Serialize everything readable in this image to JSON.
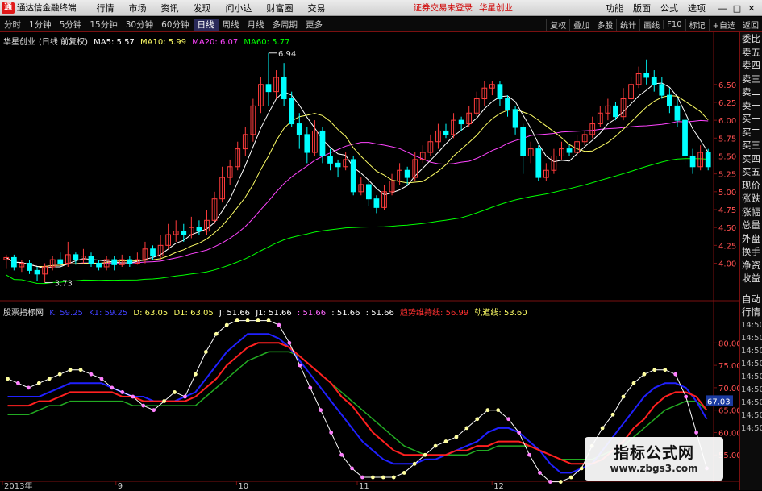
{
  "menubar": {
    "app_title": "通达信金融终端",
    "items": [
      "行情",
      "市场",
      "资讯",
      "发现",
      "问小达",
      "财富圈",
      "交易"
    ],
    "notice": "证券交易未登录",
    "notice2": "华星创业",
    "right_items": [
      "功能",
      "版面",
      "公式",
      "选项"
    ],
    "window_controls": [
      "—",
      "□",
      "✕"
    ]
  },
  "toolbar": {
    "periods": [
      "分时",
      "1分钟",
      "5分钟",
      "15分钟",
      "30分钟",
      "60分钟",
      "日线",
      "周线",
      "月线",
      "多周期",
      "更多"
    ],
    "active": "日线",
    "right_items": [
      "复权",
      "叠加",
      "多股",
      "统计",
      "画线",
      "F10",
      "标记",
      "+自选",
      "返回"
    ]
  },
  "main_info": {
    "stock": "华星创业",
    "mode": "(日线 前复权)",
    "ma5": "MA5: 5.57",
    "ma10": "MA10: 5.99",
    "ma20": "MA20: 6.07",
    "ma60": "MA60: 5.77"
  },
  "indicator_info": {
    "name": "股票指标网",
    "k": "K: 59.25",
    "k1": "K1: 59.25",
    "d": "D: 63.05",
    "d1": "D1: 63.05",
    "j": "J: 51.66",
    "j1": "J1: 51.66",
    "v1": ": 51.66",
    "v2": ": 51.66",
    "v3": ": 51.66",
    "trend": "趋势维持线: 56.99",
    "track": "轨道线: 53.60"
  },
  "annotations": {
    "high": "6.94",
    "low": "3.73"
  },
  "price_axis": [
    "6.50",
    "6.25",
    "6.00",
    "5.75",
    "5.50",
    "5.25",
    "5.00",
    "4.75",
    "4.50",
    "4.25",
    "4.00"
  ],
  "ind_axis": [
    "80.00",
    "75.00",
    "70.00",
    "65.00",
    "60.00",
    "55.00"
  ],
  "ind_current": "67.03",
  "date_axis": [
    "2013年",
    "9",
    "10",
    "11",
    "12"
  ],
  "right_panel": {
    "items": [
      "委比",
      "卖五",
      "卖四",
      "卖三",
      "卖二",
      "卖一",
      "买一",
      "买二",
      "买三",
      "买四",
      "买五",
      "现价",
      "涨跌",
      "涨幅",
      "总量",
      "外盘",
      "换手",
      "净资",
      "收益"
    ],
    "items2": [
      "自动",
      "行情"
    ],
    "times": [
      "14:50",
      "14:50",
      "14:50",
      "14:50",
      "14:50",
      "14:50",
      "14:50",
      "14:50",
      "14:50"
    ]
  },
  "watermark": {
    "title": "指标公式网",
    "url": "www.zbgs3.com"
  },
  "colors": {
    "up": "#ff3c3c",
    "down": "#00ffff",
    "ma5": "#ffffff",
    "ma10": "#ffff66",
    "ma20": "#ff44ff",
    "ma60": "#00ff00",
    "accent": "#7a1010"
  },
  "chart_data": {
    "type": "candlestick",
    "price_range": [
      3.6,
      7.05
    ],
    "candles": [
      [
        4.05,
        4.08,
        3.92,
        4.12
      ],
      [
        4.08,
        3.95,
        3.9,
        4.12
      ],
      [
        3.95,
        4.0,
        3.88,
        4.05
      ],
      [
        4.0,
        3.9,
        3.85,
        4.05
      ],
      [
        3.9,
        3.85,
        3.75,
        3.95
      ],
      [
        3.85,
        3.95,
        3.73,
        4.0
      ],
      [
        3.95,
        4.05,
        3.9,
        4.1
      ],
      [
        4.05,
        4.0,
        3.95,
        4.15
      ],
      [
        4.0,
        4.12,
        3.95,
        4.3
      ],
      [
        4.12,
        4.05,
        3.98,
        4.15
      ],
      [
        4.05,
        4.1,
        4.0,
        4.2
      ],
      [
        4.1,
        4.0,
        3.95,
        4.15
      ],
      [
        4.0,
        3.95,
        3.9,
        4.05
      ],
      [
        3.95,
        4.05,
        3.9,
        4.1
      ],
      [
        4.05,
        3.98,
        3.9,
        4.1
      ],
      [
        3.98,
        4.05,
        3.95,
        4.12
      ],
      [
        4.05,
        4.0,
        3.95,
        4.1
      ],
      [
        4.0,
        4.05,
        3.98,
        4.15
      ],
      [
        4.05,
        4.2,
        4.0,
        4.3
      ],
      [
        4.2,
        4.1,
        4.05,
        4.25
      ],
      [
        4.1,
        4.25,
        4.05,
        4.4
      ],
      [
        4.25,
        4.4,
        4.2,
        4.55
      ],
      [
        4.4,
        4.45,
        4.3,
        4.6
      ],
      [
        4.45,
        4.4,
        4.3,
        4.55
      ],
      [
        4.4,
        4.5,
        4.35,
        4.65
      ],
      [
        4.5,
        4.45,
        4.4,
        4.6
      ],
      [
        4.45,
        4.6,
        4.4,
        4.75
      ],
      [
        4.6,
        4.9,
        4.55,
        5.0
      ],
      [
        4.9,
        5.2,
        4.85,
        5.35
      ],
      [
        5.2,
        5.35,
        5.1,
        5.45
      ],
      [
        5.35,
        5.6,
        5.3,
        5.7
      ],
      [
        5.6,
        5.8,
        5.5,
        5.9
      ],
      [
        5.8,
        6.2,
        5.7,
        6.3
      ],
      [
        6.2,
        6.5,
        6.1,
        6.6
      ],
      [
        6.5,
        6.4,
        6.2,
        6.94
      ],
      [
        6.4,
        6.6,
        6.3,
        6.7
      ],
      [
        6.6,
        6.3,
        6.2,
        6.8
      ],
      [
        6.3,
        5.95,
        5.9,
        6.4
      ],
      [
        5.95,
        5.8,
        5.6,
        6.1
      ],
      [
        5.8,
        5.55,
        5.4,
        5.9
      ],
      [
        5.55,
        5.85,
        5.5,
        6.0
      ],
      [
        5.85,
        5.5,
        5.4,
        5.9
      ],
      [
        5.5,
        5.4,
        5.3,
        5.6
      ],
      [
        5.4,
        5.35,
        5.2,
        5.45
      ],
      [
        5.35,
        5.45,
        5.3,
        5.55
      ],
      [
        5.45,
        5.0,
        4.95,
        5.5
      ],
      [
        5.0,
        5.1,
        4.95,
        5.2
      ],
      [
        5.1,
        4.9,
        4.8,
        5.15
      ],
      [
        4.9,
        4.78,
        4.7,
        4.95
      ],
      [
        4.78,
        5.0,
        4.75,
        5.1
      ],
      [
        5.0,
        5.15,
        4.95,
        5.25
      ],
      [
        5.15,
        5.3,
        5.1,
        5.4
      ],
      [
        5.3,
        5.2,
        5.1,
        5.35
      ],
      [
        5.2,
        5.45,
        5.15,
        5.55
      ],
      [
        5.45,
        5.55,
        5.4,
        5.65
      ],
      [
        5.55,
        5.7,
        5.5,
        5.8
      ],
      [
        5.7,
        5.85,
        5.6,
        5.95
      ],
      [
        5.85,
        5.8,
        5.75,
        5.95
      ],
      [
        5.8,
        6.0,
        5.75,
        6.1
      ],
      [
        6.0,
        5.95,
        5.85,
        6.05
      ],
      [
        5.95,
        6.1,
        5.9,
        6.2
      ],
      [
        6.1,
        6.3,
        6.05,
        6.4
      ],
      [
        6.3,
        6.45,
        6.2,
        6.55
      ],
      [
        6.45,
        6.5,
        6.35,
        6.55
      ],
      [
        6.5,
        6.3,
        6.2,
        6.55
      ],
      [
        6.3,
        6.15,
        6.05,
        6.35
      ],
      [
        6.15,
        5.9,
        5.8,
        6.2
      ],
      [
        5.9,
        5.5,
        5.25,
        5.95
      ],
      [
        5.5,
        5.6,
        5.4,
        5.7
      ],
      [
        5.6,
        5.2,
        5.15,
        5.65
      ],
      [
        5.2,
        5.3,
        5.15,
        5.4
      ],
      [
        5.3,
        5.5,
        5.25,
        5.6
      ],
      [
        5.5,
        5.6,
        5.45,
        5.7
      ],
      [
        5.6,
        5.55,
        5.5,
        5.65
      ],
      [
        5.55,
        5.7,
        5.5,
        5.8
      ],
      [
        5.7,
        5.8,
        5.65,
        5.85
      ],
      [
        5.8,
        5.95,
        5.75,
        6.05
      ],
      [
        5.95,
        6.1,
        5.9,
        6.2
      ],
      [
        6.1,
        6.2,
        6.0,
        6.3
      ],
      [
        6.2,
        6.05,
        6.0,
        6.25
      ],
      [
        6.05,
        6.3,
        6.0,
        6.45
      ],
      [
        6.3,
        6.5,
        6.25,
        6.6
      ],
      [
        6.5,
        6.65,
        6.45,
        6.75
      ],
      [
        6.65,
        6.6,
        6.5,
        6.85
      ],
      [
        6.6,
        6.5,
        6.4,
        6.7
      ],
      [
        6.5,
        6.35,
        6.3,
        6.6
      ],
      [
        6.35,
        6.2,
        6.1,
        6.45
      ],
      [
        6.2,
        6.0,
        5.9,
        6.3
      ],
      [
        6.0,
        5.5,
        5.4,
        6.05
      ],
      [
        5.5,
        5.35,
        5.25,
        5.6
      ],
      [
        5.35,
        5.55,
        5.3,
        5.65
      ],
      [
        5.55,
        5.35,
        5.3,
        5.6
      ]
    ],
    "ind_range": [
      50,
      86
    ],
    "k_values": [
      70,
      69,
      68,
      69,
      70,
      71,
      72,
      73,
      72,
      71,
      70,
      69,
      68,
      67,
      66,
      67,
      68,
      68,
      71,
      75,
      78,
      81,
      83,
      84,
      84,
      84,
      83,
      80,
      76,
      72,
      68,
      64,
      60,
      57,
      54,
      52,
      51,
      51,
      52,
      53,
      54,
      55,
      56,
      57,
      58,
      60,
      62,
      63,
      62,
      60,
      57,
      53,
      50,
      49,
      50,
      52,
      55,
      58,
      61,
      64,
      67,
      70,
      72,
      73,
      72,
      69,
      64,
      59
    ],
    "d_values": [
      68,
      68,
      68,
      68,
      69,
      70,
      71,
      71,
      71,
      71,
      70,
      69,
      68,
      68,
      67,
      67,
      67,
      68,
      69,
      72,
      75,
      78,
      80,
      82,
      82,
      82,
      81,
      79,
      76,
      73,
      70,
      67,
      64,
      61,
      58,
      56,
      54,
      53,
      53,
      53,
      54,
      54,
      55,
      56,
      57,
      58,
      60,
      61,
      61,
      60,
      58,
      56,
      53,
      51,
      51,
      52,
      53,
      56,
      59,
      62,
      65,
      68,
      70,
      71,
      71,
      70,
      67,
      63
    ],
    "j_values": [
      72,
      71,
      70,
      71,
      72,
      73,
      74,
      74,
      73,
      72,
      70,
      69,
      68,
      66,
      65,
      67,
      69,
      68,
      73,
      78,
      82,
      84,
      85,
      85,
      85,
      85,
      84,
      80,
      75,
      70,
      65,
      60,
      55,
      52,
      50,
      50,
      50,
      50,
      51,
      53,
      55,
      57,
      58,
      59,
      61,
      63,
      65,
      65,
      63,
      60,
      55,
      51,
      49,
      49,
      50,
      52,
      57,
      61,
      64,
      68,
      71,
      73,
      74,
      74,
      73,
      68,
      60,
      52
    ],
    "trend_values": [
      66,
      66,
      66,
      67,
      67,
      68,
      69,
      69,
      69,
      69,
      69,
      68,
      68,
      67,
      67,
      67,
      67,
      67,
      68,
      70,
      72,
      75,
      77,
      79,
      80,
      80,
      80,
      79,
      77,
      75,
      73,
      71,
      68,
      66,
      63,
      60,
      58,
      56,
      55,
      55,
      55,
      55,
      55,
      56,
      56,
      57,
      57,
      58,
      58,
      58,
      57,
      56,
      55,
      54,
      53,
      53,
      53,
      54,
      56,
      58,
      61,
      63,
      66,
      68,
      69,
      69,
      68,
      65
    ],
    "track_values": [
      64,
      64,
      64,
      65,
      66,
      66,
      67,
      67,
      67,
      67,
      67,
      67,
      66,
      66,
      66,
      66,
      66,
      66,
      66,
      68,
      70,
      72,
      74,
      76,
      77,
      78,
      78,
      78,
      77,
      75,
      73,
      71,
      69,
      67,
      65,
      63,
      61,
      59,
      57,
      56,
      55,
      55,
      55,
      55,
      55,
      56,
      56,
      57,
      57,
      57,
      57,
      56,
      55,
      54,
      54,
      54,
      54,
      55,
      56,
      57,
      59,
      61,
      63,
      65,
      66,
      67,
      67,
      65
    ]
  }
}
